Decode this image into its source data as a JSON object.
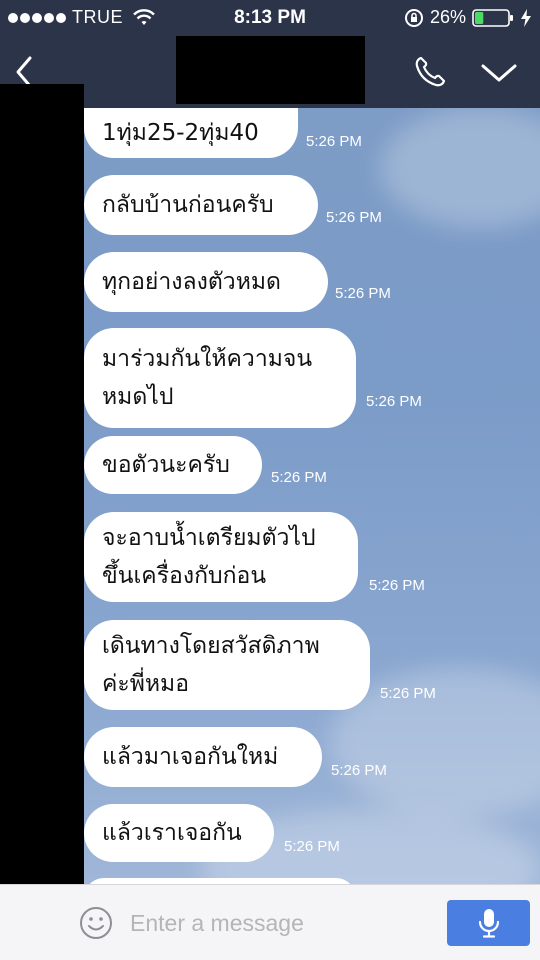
{
  "status_bar": {
    "carrier": "TRUE",
    "time": "8:13 PM",
    "battery_percent": "26%",
    "battery_level": 0.26,
    "battery_color": "#4cd964"
  },
  "nav": {
    "back_icon": "chevron-left-icon",
    "call_icon": "phone-icon",
    "menu_icon": "chevron-down-icon"
  },
  "messages": [
    {
      "text": "1ทุ่ม25-2ทุ่ม40",
      "time": "5:26 PM"
    },
    {
      "text": "กลับบ้านก่อนครับ",
      "time": "5:26 PM"
    },
    {
      "text": "ทุกอย่างลงตัวหมด",
      "time": "5:26 PM"
    },
    {
      "lines": [
        "มาร่วมกันให้ความจน",
        "หมดไป"
      ],
      "time": "5:26 PM"
    },
    {
      "text": "ขอตัวนะครับ",
      "time": "5:26 PM"
    },
    {
      "lines": [
        "จะอาบน้ำเตรียมตัวไป",
        "ขึ้นเครื่องกับก่อน"
      ],
      "time": "5:26 PM"
    },
    {
      "lines": [
        "เดินทางโดยสวัสดิภาพ",
        "ค่ะพี่หมอ"
      ],
      "time": "5:26 PM"
    },
    {
      "text": "แล้วมาเจอกันใหม่",
      "time": "5:26 PM"
    },
    {
      "text": "แล้วเราเจอกัน",
      "time": "5:26 PM"
    }
  ],
  "input": {
    "placeholder": "Enter a message",
    "accent_color": "#4a7ee0"
  }
}
